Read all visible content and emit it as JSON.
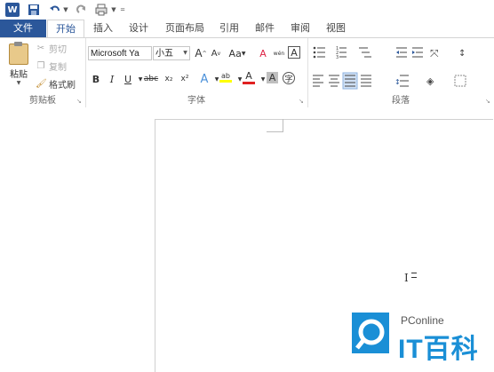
{
  "qat": {
    "logo_letter": "W"
  },
  "tabs": [
    "文件",
    "开始",
    "插入",
    "设计",
    "页面布局",
    "引用",
    "邮件",
    "审阅",
    "视图"
  ],
  "clipboard": {
    "paste": "粘贴",
    "cut": "剪切",
    "copy": "复制",
    "format_painter": "格式刷",
    "label": "剪贴板"
  },
  "font": {
    "name": "Microsoft Ya",
    "size": "小五",
    "label": "字体",
    "grow": "A",
    "shrink": "A",
    "change_case": "Aa",
    "clear_format": "A",
    "bold": "B",
    "italic": "I",
    "underline": "U",
    "strike": "abc",
    "sub": "x₂",
    "sup": "x²",
    "effects": "A",
    "highlight": "ab",
    "color": "A",
    "shading": "A",
    "phonetic": "wén",
    "border": "A"
  },
  "paragraph": {
    "label": "段落"
  },
  "watermark": {
    "brand": "PConline",
    "title": "IT百科"
  },
  "colors": {
    "accent": "#2b579a",
    "watermark_blue": "#1a8fd6",
    "highlight": "#ffff00",
    "font_red": "#e02020"
  }
}
